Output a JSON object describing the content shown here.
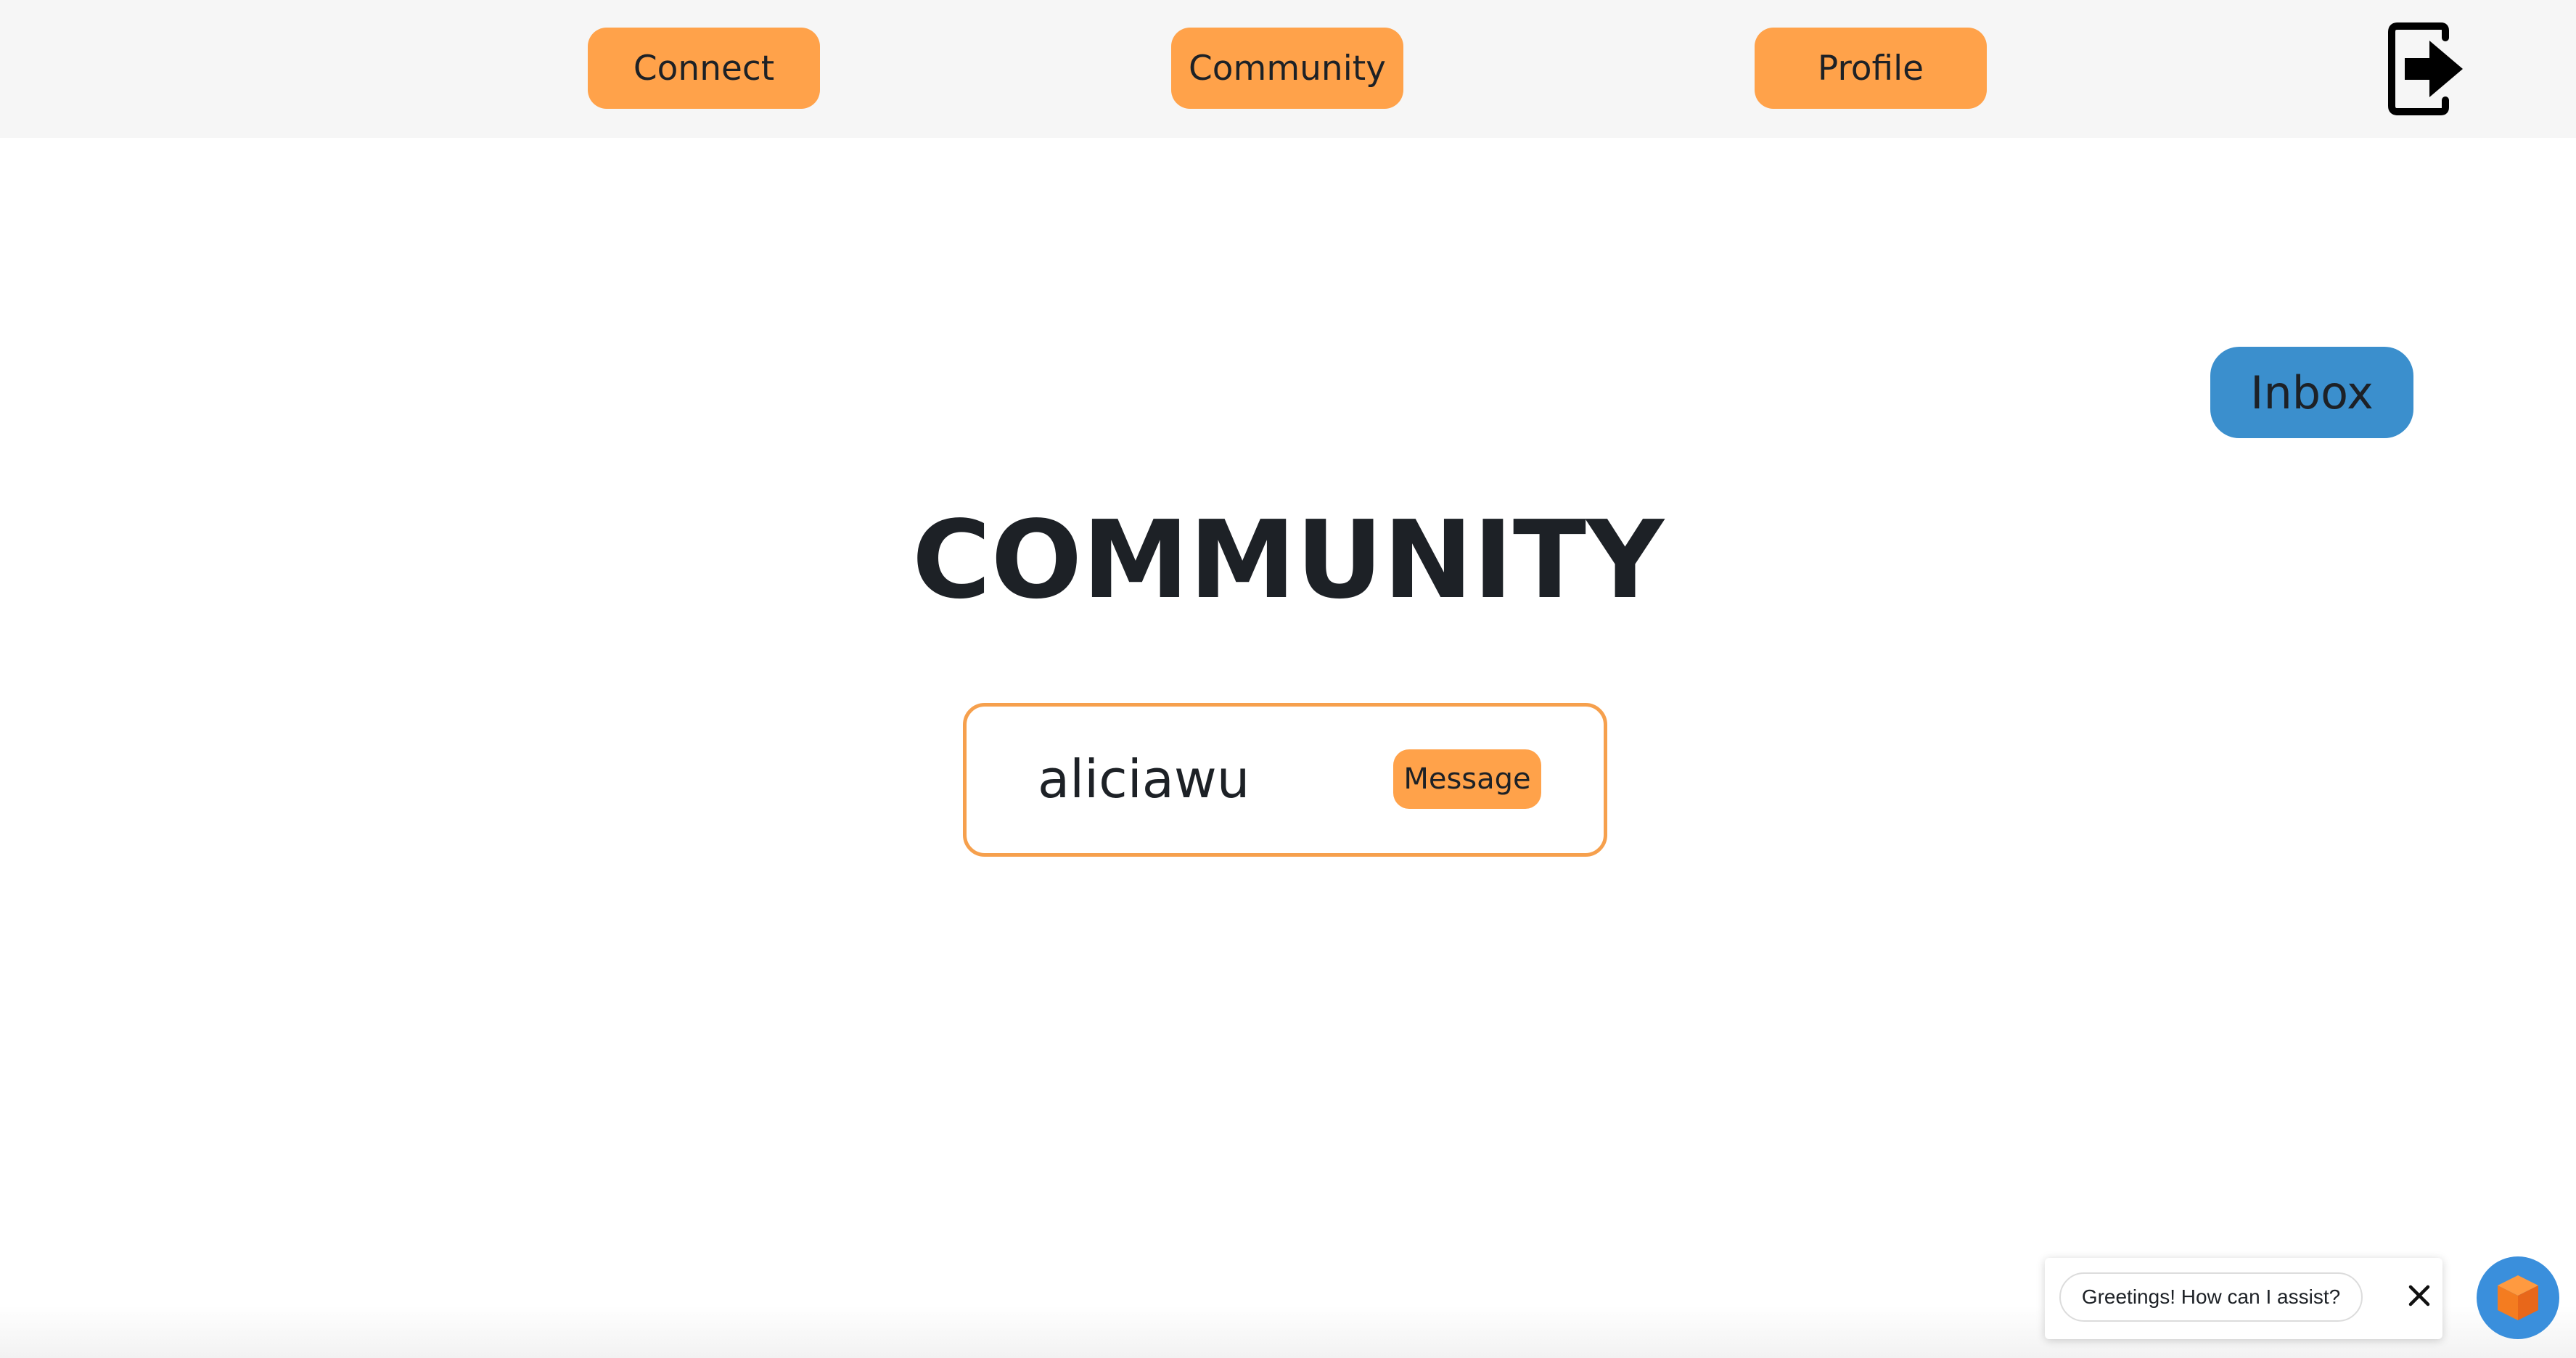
{
  "nav": {
    "connect_label": "Connect",
    "community_label": "Community",
    "profile_label": "Profile",
    "logout_icon": "logout-icon"
  },
  "inbox": {
    "label": "Inbox"
  },
  "page": {
    "title": "COMMUNITY"
  },
  "community": {
    "users": [
      {
        "username": "aliciawu",
        "action_label": "Message"
      }
    ]
  },
  "chat_widget": {
    "greeting": "Greetings! How can I assist?",
    "close_icon": "close-icon",
    "launcher_icon": "cube-icon"
  },
  "colors": {
    "accent_orange": "#ffa24a",
    "card_border": "#f6a04d",
    "inbox_blue": "#3b8fcd",
    "launcher_blue": "#3a8fdc",
    "text_dark": "#1d2126",
    "navbar_bg": "#f6f6f6"
  }
}
